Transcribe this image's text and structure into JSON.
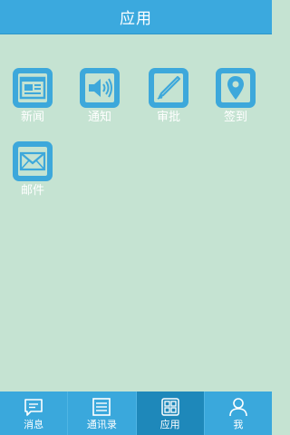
{
  "header": {
    "title": "应用"
  },
  "apps": [
    {
      "label": "新闻",
      "icon": "news-icon"
    },
    {
      "label": "通知",
      "icon": "speaker-icon"
    },
    {
      "label": "审批",
      "icon": "pen-icon"
    },
    {
      "label": "签到",
      "icon": "location-pin-icon"
    },
    {
      "label": "邮件",
      "icon": "mail-icon"
    }
  ],
  "tabbar": {
    "active": "应用",
    "tabs": [
      {
        "label": "消息",
        "icon": "message-icon"
      },
      {
        "label": "通讯录",
        "icon": "contacts-icon"
      },
      {
        "label": "应用",
        "icon": "apps-grid-icon"
      },
      {
        "label": "我",
        "icon": "user-icon"
      }
    ]
  },
  "colors": {
    "header": "#3ba9de",
    "background": "#c5e3d2",
    "icon": "#3da8db",
    "tab_active": "#1e88ba"
  }
}
